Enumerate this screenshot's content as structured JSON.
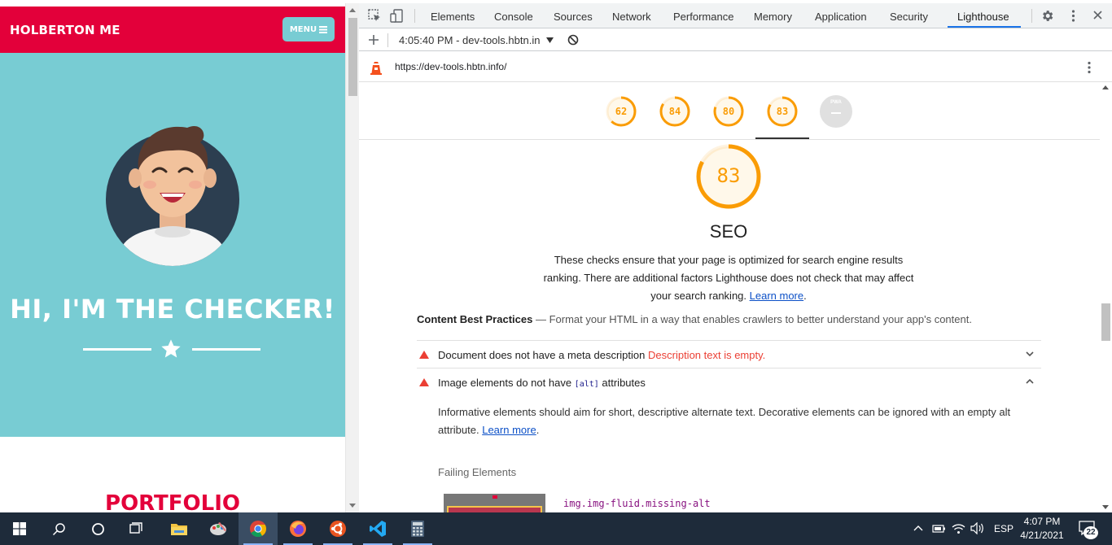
{
  "site": {
    "brand": "HOLBERTON ME",
    "menu_label": "MENU",
    "hero_title": "HI, I'M THE CHECKER!",
    "portfolio_title": "PORTFOLIO",
    "colors": {
      "brand": "#e3003a",
      "hero": "#78ccd3"
    }
  },
  "devtools": {
    "tabs": [
      "Elements",
      "Console",
      "Sources",
      "Network",
      "Performance",
      "Memory",
      "Application",
      "Security",
      "Lighthouse"
    ],
    "active_tab": "Lighthouse",
    "report_time": "4:05:40 PM - dev-tools.hbtn.in",
    "url": "https://dev-tools.hbtn.info/"
  },
  "lighthouse": {
    "scores": [
      {
        "value": "62",
        "fraction": 0.62
      },
      {
        "value": "84",
        "fraction": 0.84
      },
      {
        "value": "80",
        "fraction": 0.8
      },
      {
        "value": "83",
        "fraction": 0.83
      }
    ],
    "pwa_label": "PWA",
    "active_score": {
      "value": "83",
      "fraction": 0.83
    },
    "category_title": "SEO",
    "category_desc": "These checks ensure that your page is optimized for search engine results ranking. There are additional factors Lighthouse does not check that may affect your search ranking.",
    "learn_more": "Learn more",
    "group_title": "Content Best Practices",
    "group_desc": "Format your HTML in a way that enables crawlers to better understand your app's content.",
    "audits": [
      {
        "title": "Document does not have a meta description",
        "display": "Description text is empty."
      },
      {
        "title_pre": "Image elements do not have ",
        "title_code": "[alt]",
        "title_post": " attributes"
      }
    ],
    "audit_body": "Informative elements should aim for short, descriptive alternate text. Decorative elements can be ignored with an empty alt attribute.",
    "failing_heading": "Failing Elements",
    "failing_selector": "img.img-fluid.missing-alt",
    "colors": {
      "average": "#fa9c05",
      "fail": "#eb3f34",
      "link": "#0c50c7"
    }
  },
  "taskbar": {
    "language": "ESP",
    "time": "4:07 PM",
    "date": "4/21/2021",
    "notifications": "22"
  }
}
